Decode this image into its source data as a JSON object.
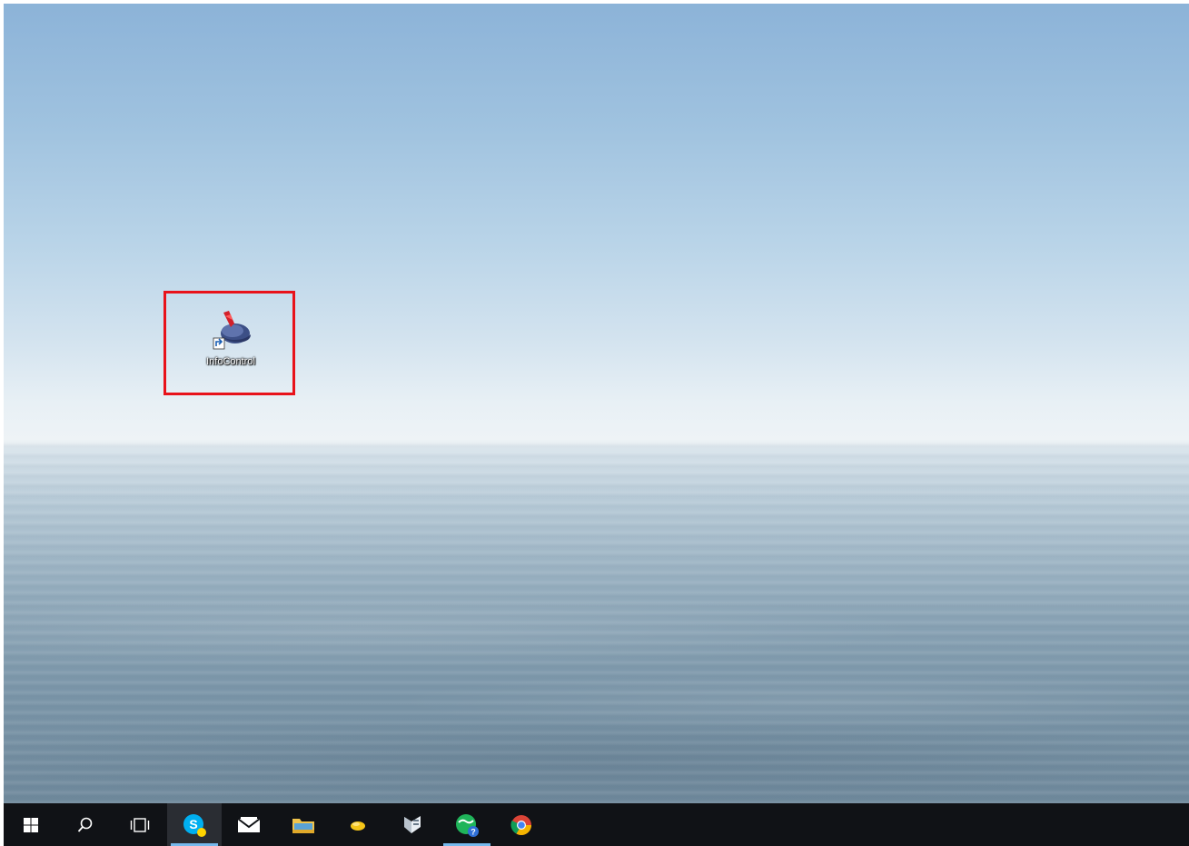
{
  "desktop": {
    "icons": [
      {
        "label": "InfoControl",
        "icon": "infocontrol-app-icon",
        "highlighted": true
      }
    ]
  },
  "highlight": {
    "color": "#e8121a"
  },
  "taskbar": {
    "items": [
      {
        "name": "start-button",
        "icon": "windows-logo-icon"
      },
      {
        "name": "search-button",
        "icon": "search-icon"
      },
      {
        "name": "task-view-button",
        "icon": "task-view-icon"
      },
      {
        "name": "skype-button",
        "icon": "skype-icon",
        "active": true
      },
      {
        "name": "mail-button",
        "icon": "mail-icon"
      },
      {
        "name": "file-explorer-button",
        "icon": "folder-icon"
      },
      {
        "name": "app-yellow-button",
        "icon": "yellow-app-icon"
      },
      {
        "name": "app-document-button",
        "icon": "document-app-icon"
      },
      {
        "name": "app-green-button",
        "icon": "green-globe-icon",
        "running": true
      },
      {
        "name": "chrome-button",
        "icon": "chrome-icon"
      }
    ],
    "accent_color": "#76b9ed"
  }
}
